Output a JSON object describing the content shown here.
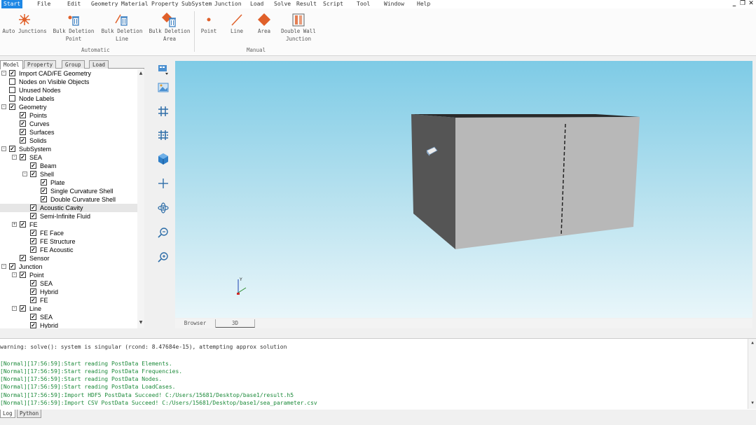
{
  "menu": {
    "items": [
      "Start",
      "File",
      "Edit",
      "Geometry",
      "Material",
      "Property",
      "SubSystem",
      "Junction",
      "Load",
      "Solve",
      "Result",
      "Script",
      "Tool",
      "Window",
      "Help"
    ],
    "active": "Start",
    "window_controls": [
      "_",
      "❐",
      "✕"
    ]
  },
  "ribbon": {
    "buttons": [
      {
        "label1": "Auto Junctions",
        "label2": "",
        "icon": "auto-junction-icon"
      },
      {
        "label1": "Bulk Deletion",
        "label2": "Point",
        "icon": "bulk-delete-point-icon"
      },
      {
        "label1": "Bulk Deletion",
        "label2": "Line",
        "icon": "bulk-delete-line-icon"
      },
      {
        "label1": "Bulk Deletion",
        "label2": "Area",
        "icon": "bulk-delete-area-icon"
      },
      {
        "label1": "Point",
        "label2": "",
        "icon": "point-icon"
      },
      {
        "label1": "Line",
        "label2": "",
        "icon": "line-icon"
      },
      {
        "label1": "Area",
        "label2": "",
        "icon": "area-icon"
      },
      {
        "label1": "Double Wall",
        "label2": "Junction",
        "icon": "double-wall-icon"
      }
    ],
    "groups": [
      "Automatic",
      "Manual"
    ]
  },
  "left_panel": {
    "tabs": [
      "Model",
      "Property",
      "Group",
      "Load"
    ],
    "active_tab": "Model",
    "tree": [
      {
        "label": "Import CAD/FE Geometry",
        "checked": true,
        "expander": "-"
      },
      {
        "label": "Nodes on Visible Objects",
        "checked": false,
        "expander": ""
      },
      {
        "label": "Unused Nodes",
        "checked": false,
        "expander": ""
      },
      {
        "label": "Node Labels",
        "checked": false,
        "expander": ""
      },
      {
        "label": "Geometry",
        "checked": true,
        "expander": "-"
      },
      {
        "label": "Points",
        "checked": true,
        "expander": ""
      },
      {
        "label": "Curves",
        "checked": true,
        "expander": ""
      },
      {
        "label": "Surfaces",
        "checked": true,
        "expander": ""
      },
      {
        "label": "Solids",
        "checked": true,
        "expander": ""
      },
      {
        "label": "SubSystem",
        "checked": true,
        "expander": "-"
      },
      {
        "label": "SEA",
        "checked": true,
        "expander": "-"
      },
      {
        "label": "Beam",
        "checked": true,
        "expander": ""
      },
      {
        "label": "Shell",
        "checked": true,
        "expander": "-"
      },
      {
        "label": "Plate",
        "checked": true,
        "expander": ""
      },
      {
        "label": "Single Curvature Shell",
        "checked": true,
        "expander": ""
      },
      {
        "label": "Double Curvature Shell",
        "checked": true,
        "expander": ""
      },
      {
        "label": "Acoustic Cavity",
        "checked": true,
        "expander": "",
        "highlighted": true
      },
      {
        "label": "Semi-Infinite Fluid",
        "checked": true,
        "expander": ""
      },
      {
        "label": "FE",
        "checked": true,
        "expander": "+"
      },
      {
        "label": "FE Face",
        "checked": true,
        "expander": ""
      },
      {
        "label": "FE Structure",
        "checked": true,
        "expander": ""
      },
      {
        "label": "FE Acoustic",
        "checked": true,
        "expander": ""
      },
      {
        "label": "Sensor",
        "checked": true,
        "expander": ""
      },
      {
        "label": "Junction",
        "checked": true,
        "expander": "-"
      },
      {
        "label": "Point",
        "checked": true,
        "expander": "-"
      },
      {
        "label": "SEA",
        "checked": true,
        "expander": ""
      },
      {
        "label": "Hybrid",
        "checked": true,
        "expander": ""
      },
      {
        "label": "FE",
        "checked": true,
        "expander": ""
      },
      {
        "label": "Line",
        "checked": true,
        "expander": "-"
      },
      {
        "label": "SEA",
        "checked": true,
        "expander": ""
      },
      {
        "label": "Hybrid",
        "checked": true,
        "expander": ""
      }
    ]
  },
  "view_toolbar": {
    "icons": [
      "view-select-icon",
      "image-icon",
      "grid-icon",
      "grid-alt-icon",
      "cube-icon",
      "pan-icon",
      "rotate-icon",
      "zoom-out-icon",
      "zoom-in-icon"
    ]
  },
  "viewport": {
    "axis_label_y": "Y",
    "box_colors": {
      "front": "#b8b8b8",
      "side": "#555555",
      "top": "#2a2a2a"
    }
  },
  "view_tabs": [
    "Browser",
    "3D"
  ],
  "active_view_tab": "3D",
  "log": {
    "lines": [
      {
        "type": "warn",
        "text": "warning: solve(): system is singular (rcond: 8.47684e-15), attempting approx solution"
      },
      {
        "type": "info",
        "text": "[Normal][17:56:59]:Start reading PostData Elements."
      },
      {
        "type": "info",
        "text": "[Normal][17:56:59]:Start reading PostData Frequencies."
      },
      {
        "type": "info",
        "text": "[Normal][17:56:59]:Start reading PostData Nodes."
      },
      {
        "type": "info",
        "text": "[Normal][17:56:59]:Start reading PostData LoadCases."
      },
      {
        "type": "info",
        "text": "[Normal][17:56:59]:Import HDF5 PostData Succeed! C:/Users/15681/Desktop/base1/result.h5"
      },
      {
        "type": "info",
        "text": "[Normal][17:56:59]:Import CSV PostData Succeed! C:/Users/15681/Desktop/base1/sea_parameter.csv"
      }
    ]
  },
  "bottom_tabs": [
    "Log",
    "Python"
  ],
  "active_bottom_tab": "Log"
}
